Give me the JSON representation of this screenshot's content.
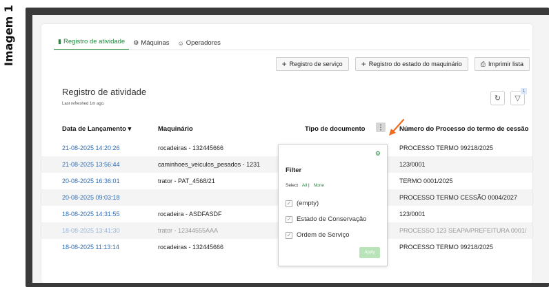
{
  "side_label": "Imagem 1",
  "tabs": [
    {
      "label": "Registro de atividade",
      "icon": "document-icon"
    },
    {
      "label": "Máquinas",
      "icon": "machine-icon"
    },
    {
      "label": "Operadores",
      "icon": "people-icon"
    }
  ],
  "actions": {
    "service_label": "Registro de serviço",
    "machine_state_label": "Registro do estado do maquinário",
    "print_label": "Imprimir lista"
  },
  "page": {
    "title": "Registro de atividade",
    "subtitle": "Last refreshed 1m ago.",
    "filter_badge": "1"
  },
  "table": {
    "headers": [
      "Data de Lançamento ▾",
      "Maquinário",
      "Tipo de documento",
      "Número do Processo do termo de cessão"
    ],
    "rows": [
      {
        "date": "21-08-2025 14:20:26",
        "machine": "rocadeiras - 132445666",
        "doc": "",
        "process": "PROCESSO TERMO 99218/2025"
      },
      {
        "date": "21-08-2025 13:56:44",
        "machine": "caminhoes_veiculos_pesados - 1231",
        "doc": "",
        "process": "123/0001"
      },
      {
        "date": "20-08-2025 16:36:01",
        "machine": "trator - PAT_4568/21",
        "doc": "",
        "process": "TERMO 0001/2025"
      },
      {
        "date": "20-08-2025 09:03:18",
        "machine": "",
        "doc": "",
        "process": "PROCESSO TERMO CESSÃO 0004/2027"
      },
      {
        "date": "18-08-2025 14:31:55",
        "machine": "rocadeira - ASDFASDF",
        "doc": "",
        "process": "123/0001"
      },
      {
        "date": "18-08-2025 13:41:30",
        "machine": "trator - 12344555AAA",
        "doc": "",
        "process": "PROCESSO 123 SEAPA/PREFEITURA 0001/"
      },
      {
        "date": "18-08-2025 11:13:14",
        "machine": "rocadeiras - 132445666",
        "doc": "",
        "process": "PROCESSO TERMO 99218/2025"
      }
    ]
  },
  "filter": {
    "title": "Filter",
    "select_label": "Select",
    "all_label": "All",
    "separator": "|",
    "none_label": "None",
    "options": [
      "(empty)",
      "Estado de Conservação",
      "Ordem de Serviço"
    ],
    "apply_label": "Apply"
  },
  "colors": {
    "accent": "#1e8a3c",
    "link": "#2b6cb8",
    "arrow": "#f06a1c"
  }
}
